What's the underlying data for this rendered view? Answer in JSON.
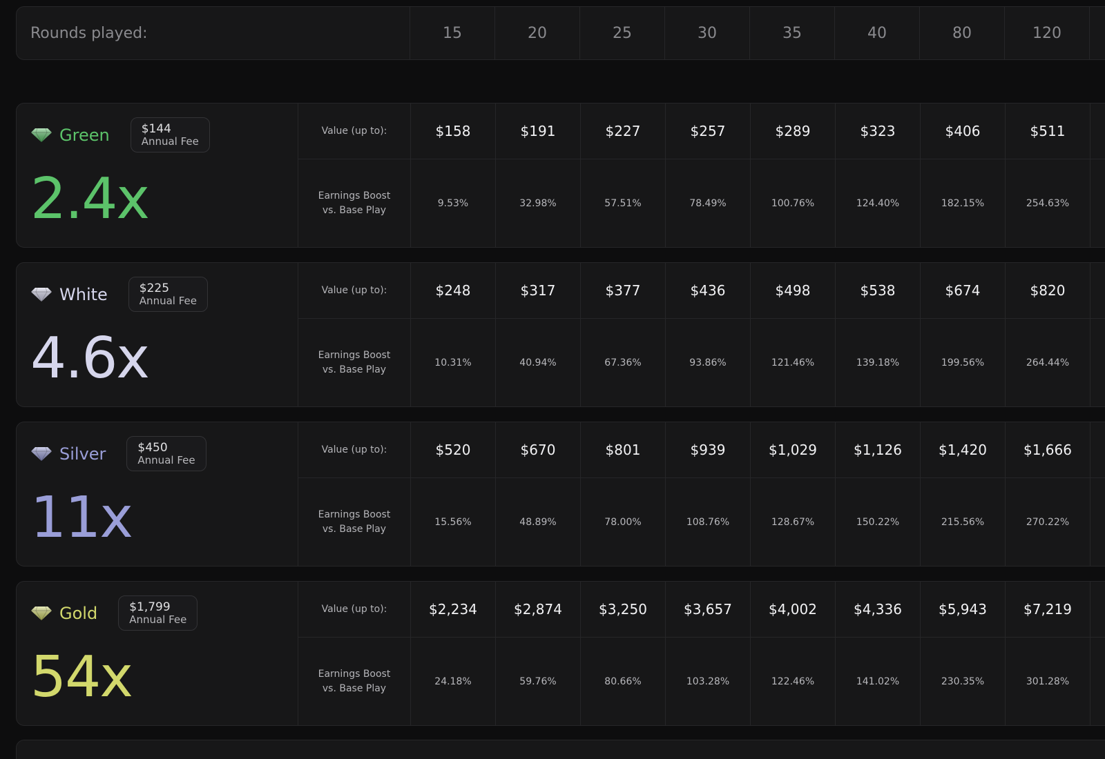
{
  "rounds": {
    "label": "Rounds played:",
    "values": [
      "15",
      "20",
      "25",
      "30",
      "35",
      "40",
      "80",
      "120"
    ]
  },
  "row_labels": {
    "value": "Value (up to):",
    "boost": "Earnings Boost\nvs. Base Play"
  },
  "tiers": [
    {
      "name": "Green",
      "fee": "$144",
      "fee_label": "Annual Fee",
      "multiplier": "2.4x",
      "color": "#5cc36a",
      "gem_icon": "green-gem-icon",
      "values": [
        "$158",
        "$191",
        "$227",
        "$257",
        "$289",
        "$323",
        "$406",
        "$511"
      ],
      "boosts": [
        "9.53%",
        "32.98%",
        "57.51%",
        "78.49%",
        "100.76%",
        "124.40%",
        "182.15%",
        "254.63%"
      ]
    },
    {
      "name": "White",
      "fee": "$225",
      "fee_label": "Annual Fee",
      "multiplier": "4.6x",
      "color": "#d6d6ec",
      "gem_icon": "white-gem-icon",
      "values": [
        "$248",
        "$317",
        "$377",
        "$436",
        "$498",
        "$538",
        "$674",
        "$820"
      ],
      "boosts": [
        "10.31%",
        "40.94%",
        "67.36%",
        "93.86%",
        "121.46%",
        "139.18%",
        "199.56%",
        "264.44%"
      ]
    },
    {
      "name": "Silver",
      "fee": "$450",
      "fee_label": "Annual Fee",
      "multiplier": "11x",
      "color": "#9a9ed8",
      "gem_icon": "silver-gem-icon",
      "values": [
        "$520",
        "$670",
        "$801",
        "$939",
        "$1,029",
        "$1,126",
        "$1,420",
        "$1,666"
      ],
      "boosts": [
        "15.56%",
        "48.89%",
        "78.00%",
        "108.76%",
        "128.67%",
        "150.22%",
        "215.56%",
        "270.22%"
      ]
    },
    {
      "name": "Gold",
      "fee": "$1,799",
      "fee_label": "Annual Fee",
      "multiplier": "54x",
      "color": "#d2d86c",
      "gem_icon": "gold-gem-icon",
      "values": [
        "$2,234",
        "$2,874",
        "$3,250",
        "$3,657",
        "$4,002",
        "$4,336",
        "$5,943",
        "$7,219"
      ],
      "boosts": [
        "24.18%",
        "59.76%",
        "80.66%",
        "103.28%",
        "122.46%",
        "141.02%",
        "230.35%",
        "301.28%"
      ]
    }
  ]
}
